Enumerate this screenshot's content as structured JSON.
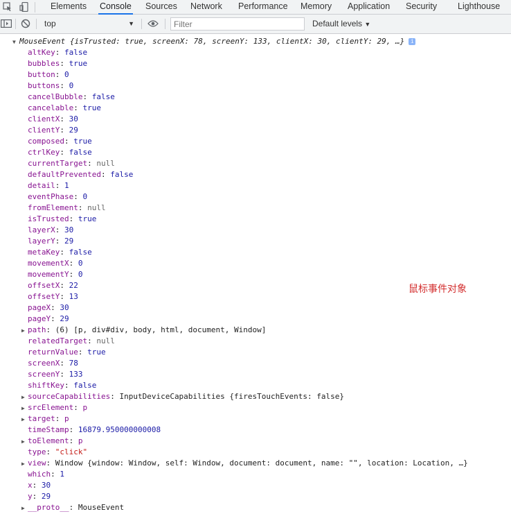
{
  "tabs": [
    "Elements",
    "Console",
    "Sources",
    "Network",
    "Performance",
    "Memory",
    "Application",
    "Security",
    "Lighthouse"
  ],
  "active_tab": "Console",
  "toolbar": {
    "context": "top",
    "filter_placeholder": "Filter",
    "levels": "Default levels"
  },
  "summary": "MouseEvent {isTrusted: true, screenX: 78, screenY: 133, clientX: 30, clientY: 29, …}",
  "props": [
    {
      "k": "altKey",
      "v": "false",
      "t": "bool"
    },
    {
      "k": "bubbles",
      "v": "true",
      "t": "bool"
    },
    {
      "k": "button",
      "v": "0",
      "t": "num"
    },
    {
      "k": "buttons",
      "v": "0",
      "t": "num"
    },
    {
      "k": "cancelBubble",
      "v": "false",
      "t": "bool"
    },
    {
      "k": "cancelable",
      "v": "true",
      "t": "bool"
    },
    {
      "k": "clientX",
      "v": "30",
      "t": "num"
    },
    {
      "k": "clientY",
      "v": "29",
      "t": "num"
    },
    {
      "k": "composed",
      "v": "true",
      "t": "bool"
    },
    {
      "k": "ctrlKey",
      "v": "false",
      "t": "bool"
    },
    {
      "k": "currentTarget",
      "v": "null",
      "t": "null"
    },
    {
      "k": "defaultPrevented",
      "v": "false",
      "t": "bool"
    },
    {
      "k": "detail",
      "v": "1",
      "t": "num"
    },
    {
      "k": "eventPhase",
      "v": "0",
      "t": "num"
    },
    {
      "k": "fromElement",
      "v": "null",
      "t": "null"
    },
    {
      "k": "isTrusted",
      "v": "true",
      "t": "bool"
    },
    {
      "k": "layerX",
      "v": "30",
      "t": "num"
    },
    {
      "k": "layerY",
      "v": "29",
      "t": "num"
    },
    {
      "k": "metaKey",
      "v": "false",
      "t": "bool"
    },
    {
      "k": "movementX",
      "v": "0",
      "t": "num"
    },
    {
      "k": "movementY",
      "v": "0",
      "t": "num"
    },
    {
      "k": "offsetX",
      "v": "22",
      "t": "num"
    },
    {
      "k": "offsetY",
      "v": "13",
      "t": "num"
    },
    {
      "k": "pageX",
      "v": "30",
      "t": "num"
    },
    {
      "k": "pageY",
      "v": "29",
      "t": "num"
    },
    {
      "k": "path",
      "v": "(6) [p, div#div, body, html, document, Window]",
      "t": "obj",
      "expandable": true
    },
    {
      "k": "relatedTarget",
      "v": "null",
      "t": "null"
    },
    {
      "k": "returnValue",
      "v": "true",
      "t": "bool"
    },
    {
      "k": "screenX",
      "v": "78",
      "t": "num"
    },
    {
      "k": "screenY",
      "v": "133",
      "t": "num"
    },
    {
      "k": "shiftKey",
      "v": "false",
      "t": "bool"
    },
    {
      "k": "sourceCapabilities",
      "v": "InputDeviceCapabilities {firesTouchEvents: false}",
      "t": "obj",
      "expandable": true
    },
    {
      "k": "srcElement",
      "v": "p",
      "t": "kw",
      "expandable": true
    },
    {
      "k": "target",
      "v": "p",
      "t": "kw",
      "expandable": true
    },
    {
      "k": "timeStamp",
      "v": "16879.950000000008",
      "t": "num"
    },
    {
      "k": "toElement",
      "v": "p",
      "t": "kw",
      "expandable": true
    },
    {
      "k": "type",
      "v": "\"click\"",
      "t": "str"
    },
    {
      "k": "view",
      "v": "Window {window: Window, self: Window, document: document, name: \"\", location: Location, …}",
      "t": "obj",
      "expandable": true
    },
    {
      "k": "which",
      "v": "1",
      "t": "num"
    },
    {
      "k": "x",
      "v": "30",
      "t": "num"
    },
    {
      "k": "y",
      "v": "29",
      "t": "num"
    },
    {
      "k": "__proto__",
      "v": "MouseEvent",
      "t": "obj",
      "expandable": true
    }
  ],
  "annotation": "鼠标事件对象",
  "colors": {
    "key": "#881391",
    "number": "#1a1aa6",
    "string": "#c41a16",
    "accent": "#1a73e8",
    "annotation": "#d32f2f"
  }
}
